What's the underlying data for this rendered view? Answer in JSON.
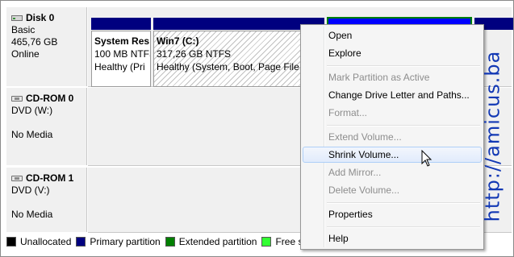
{
  "disks": [
    {
      "name": "Disk 0",
      "line1": "Basic",
      "line2": "465,76 GB",
      "line3": "Online",
      "icon": "disk-icon"
    },
    {
      "name": "CD-ROM 0",
      "line1": "DVD (W:)",
      "line2": "",
      "line3": "No Media",
      "icon": "cdrom-icon"
    },
    {
      "name": "CD-ROM 1",
      "line1": "DVD (V:)",
      "line2": "",
      "line3": "No Media",
      "icon": "cdrom-icon"
    }
  ],
  "partitions": [
    {
      "title": "System Res",
      "size": "100 MB NTFS",
      "status": "Healthy (Pri"
    },
    {
      "title": "Win7  (C:)",
      "size": "317,26 GB NTFS",
      "status": "Healthy (System, Boot, Page File, A"
    }
  ],
  "legend": [
    {
      "label": "Unallocated",
      "color": "#000000"
    },
    {
      "label": "Primary partition",
      "color": "#00007f"
    },
    {
      "label": "Extended partition",
      "color": "#007f00"
    },
    {
      "label": "Free sp",
      "color": "#33ff33"
    }
  ],
  "context_menu": {
    "items": [
      {
        "label": "Open",
        "enabled": true
      },
      {
        "label": "Explore",
        "enabled": true
      },
      {
        "label": "Mark Partition as Active",
        "enabled": false
      },
      {
        "label": "Change Drive Letter and Paths...",
        "enabled": true
      },
      {
        "label": "Format...",
        "enabled": false
      },
      {
        "label": "Extend Volume...",
        "enabled": false
      },
      {
        "label": "Shrink Volume...",
        "enabled": true,
        "highlighted": true
      },
      {
        "label": "Add Mirror...",
        "enabled": false
      },
      {
        "label": "Delete Volume...",
        "enabled": false
      },
      {
        "label": "Properties",
        "enabled": true
      },
      {
        "label": "Help",
        "enabled": true
      }
    ]
  },
  "watermark": "http://amicus.ba"
}
